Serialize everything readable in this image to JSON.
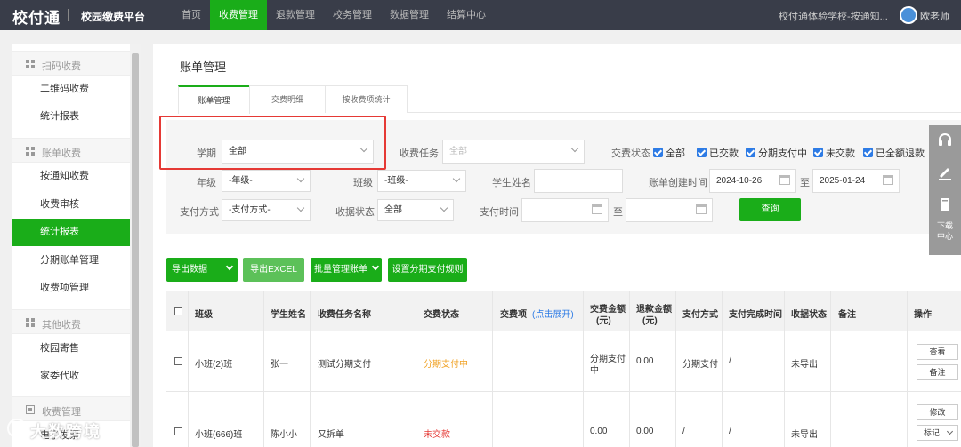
{
  "header": {
    "logo": "校付通",
    "platform": "校园缴费平台",
    "nav": [
      "首页",
      "收费管理",
      "退款管理",
      "校务管理",
      "数据管理",
      "结算中心"
    ],
    "active_nav": "收费管理",
    "school": "校付通体验学校-按通知...",
    "user": "欧老师"
  },
  "sidebar": {
    "groups": [
      {
        "label": "扫码收费",
        "items": [
          "二维码收费",
          "统计报表"
        ]
      },
      {
        "label": "账单收费",
        "items": [
          "按通知收费",
          "收费审核",
          "统计报表",
          "分期账单管理",
          "收费项管理"
        ]
      },
      {
        "label": "其他收费",
        "items": [
          "校园寄售",
          "家委代收"
        ]
      },
      {
        "label": "收费管理",
        "items": [
          "电子发票"
        ]
      }
    ],
    "active_item": "统计报表"
  },
  "main": {
    "title": "账单管理",
    "tabs": [
      "账单管理",
      "交费明细",
      "按收费项统计"
    ],
    "filters": {
      "term_label": "学期",
      "term_value": "全部",
      "task_label": "收费任务",
      "task_placeholder": "全部",
      "pay_status_label": "交费状态",
      "pay_status_options": [
        "全部",
        "已交款",
        "分期支付中",
        "未交款",
        "已全额退款"
      ],
      "grade_label": "年级",
      "grade_value": "-年级-",
      "class_label": "班级",
      "class_value": "-班级-",
      "student_label": "学生姓名",
      "student_value": "",
      "created_label": "账单创建时间",
      "created_from": "2024-10-26",
      "to_label": "至",
      "created_to": "2025-01-24",
      "method_label": "支付方式",
      "method_value": "-支付方式-",
      "receipt_label": "收据状态",
      "receipt_value": "全部",
      "paytime_label": "支付时间",
      "paytime_to_label": "至",
      "search_button": "查询"
    },
    "actions": {
      "export_data": "导出数据",
      "export_excel": "导出EXCEL",
      "batch_manage": "批量管理账单",
      "installment_rule": "设置分期支付规则"
    },
    "table": {
      "headers": {
        "class": "班级",
        "student": "学生姓名",
        "task": "收费任务名称",
        "status": "交费状态",
        "item": "交费项",
        "item_expand": "(点击展开)",
        "amount_1": "交费金额",
        "amount_2": "(元)",
        "refund_1": "退款金额",
        "refund_2": "(元)",
        "method": "支付方式",
        "finish_time": "支付完成时间",
        "receipt": "收据状态",
        "remark": "备注",
        "ops": "操作"
      },
      "rows": [
        {
          "class": "小班(2)班",
          "student": "张一",
          "task": "测试分期支付",
          "status": "分期支付中",
          "status_color": "#f0a020",
          "amount_1": "分期支付",
          "amount_2": "中",
          "refund": "0.00",
          "method": "分期支付",
          "finish_time": "/",
          "receipt": "未导出",
          "ops": [
            "查看",
            "备注"
          ]
        },
        {
          "class": "小班(666)班",
          "student": "陈小小",
          "task": "又拆单",
          "status": "未交款",
          "status_color": "#e53935",
          "amount": "0.00",
          "refund": "0.00",
          "method": "/",
          "finish_time": "/",
          "receipt": "未导出",
          "ops": [
            "修改",
            "标记"
          ]
        }
      ]
    }
  },
  "right_toolbar": {
    "download": "下载中心"
  },
  "watermark": "大数跨境"
}
